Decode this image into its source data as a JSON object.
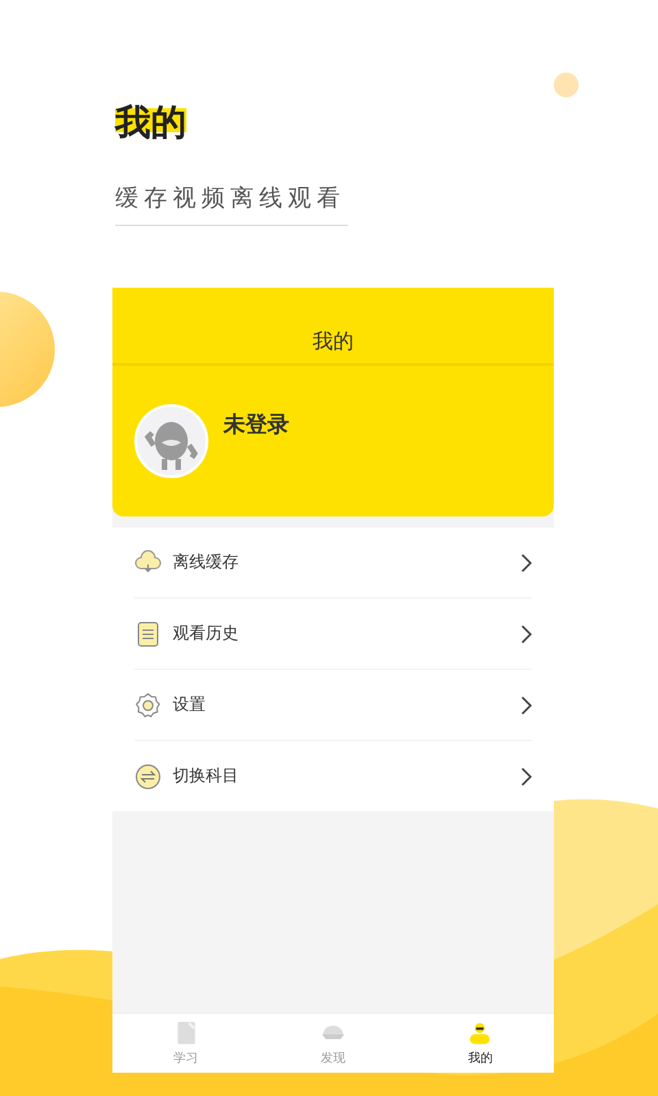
{
  "promo": {
    "title": "我的",
    "subtitle": "缓存视频离线观看"
  },
  "header": {
    "title": "我的"
  },
  "profile": {
    "name": "未登录"
  },
  "menu": [
    {
      "kind": "cloud",
      "label": "离线缓存"
    },
    {
      "kind": "document",
      "label": "观看历史"
    },
    {
      "kind": "gear",
      "label": "设置"
    },
    {
      "kind": "swap",
      "label": "切换科目"
    }
  ],
  "tabs": [
    {
      "kind": "book",
      "label": "学习",
      "selected": false
    },
    {
      "kind": "discover",
      "label": "发现",
      "selected": false
    },
    {
      "kind": "person",
      "label": "我的",
      "selected": true
    }
  ]
}
